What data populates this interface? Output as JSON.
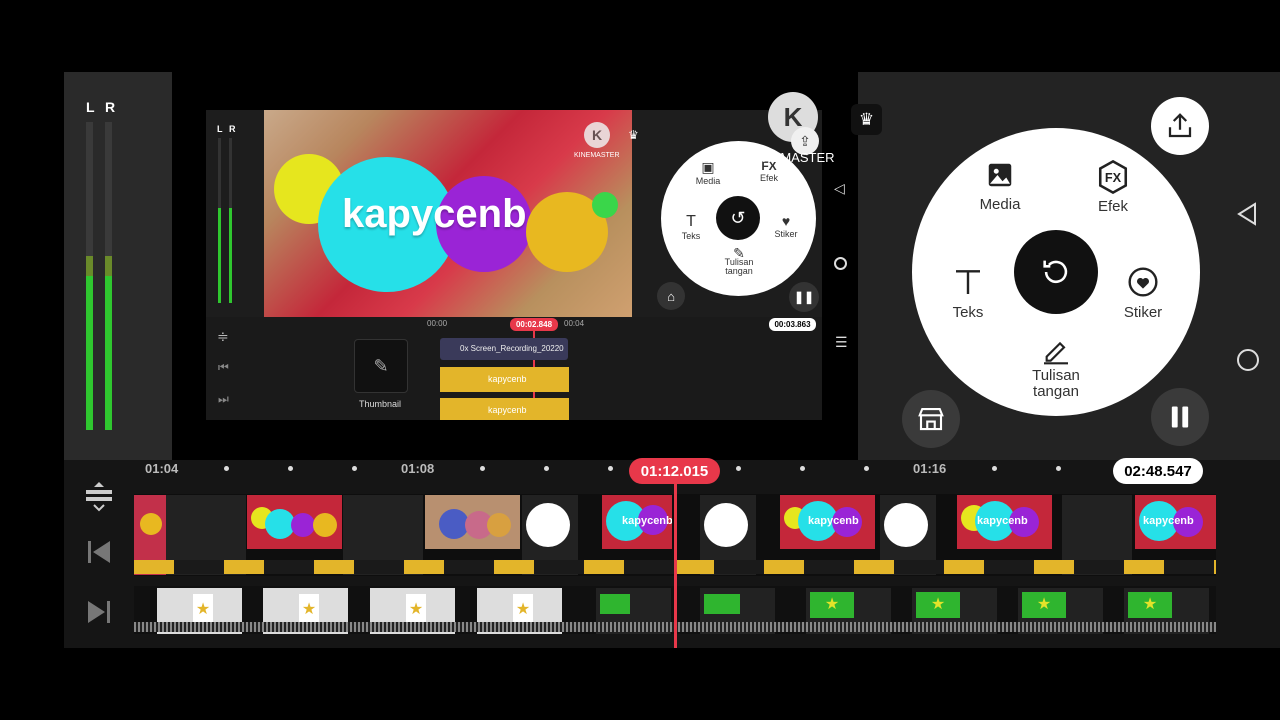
{
  "vu": {
    "left": "L",
    "right": "R",
    "level_left": 0.6,
    "level_right": 0.6
  },
  "inner": {
    "vu_left": "L",
    "vu_right": "R",
    "brand": "KINEMASTER",
    "video_text": "kapycenb",
    "time_marks": [
      "00:00",
      "00:04"
    ],
    "playhead_time": "00:02.848",
    "duration": "00:03.863",
    "thumbnail_label": "Thumbnail",
    "clip_name": "0x Screen_Recording_20220",
    "text_layers": [
      "kapycenb",
      "kapycenb"
    ],
    "wheel": {
      "media": "Media",
      "effect": "Efek",
      "text": "Teks",
      "sticker": "Stiker",
      "handwriting": "Tulisan\ntangan"
    }
  },
  "overlay_brand": "KINEMASTER",
  "wheel": {
    "media": "Media",
    "effect": "Efek",
    "text": "Teks",
    "sticker": "Stiker",
    "handwriting_line1": "Tulisan",
    "handwriting_line2": "tangan"
  },
  "timeline": {
    "ticks": [
      "01:04",
      "01:08",
      "01:16"
    ],
    "playhead_time": "01:12.015",
    "duration": "02:48.547"
  },
  "thumb_texts": [
    "kapycenb",
    "kapycenb",
    "kapycenb",
    "kapycenb"
  ],
  "colors": {
    "accent": "#e8384a",
    "vu": "#2fc72f",
    "text_layer": "#e3b52a",
    "fill_green": "#2fb52f"
  },
  "icons": [
    "export-icon",
    "store-icon",
    "pause-icon",
    "undo-icon",
    "back-icon",
    "home-icon",
    "menu-icon",
    "crown-icon"
  ]
}
